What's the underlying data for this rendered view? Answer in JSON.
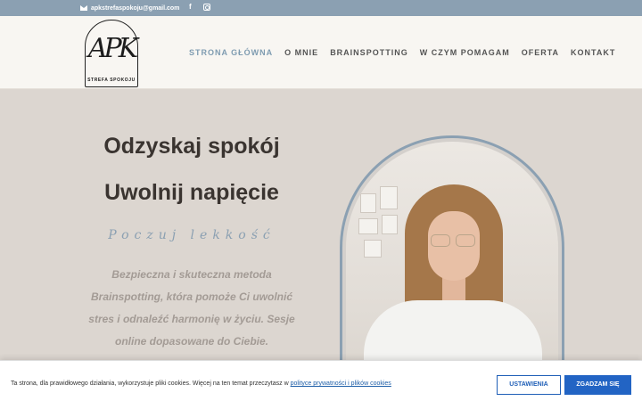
{
  "topbar": {
    "email": "apkstrefaspokoju@gmail.com",
    "facebook_icon": "facebook-icon",
    "instagram_icon": "instagram-icon"
  },
  "logo": {
    "monogram": "APK",
    "subtitle": "STREFA SPOKOJU"
  },
  "nav": {
    "items": [
      "STRONA GŁÓWNA",
      "O MNIE",
      "BRAINSPOTTING",
      "W CZYM POMAGAM",
      "OFERTA",
      "KONTAKT"
    ],
    "active_index": 0
  },
  "hero": {
    "title1": "Odzyskaj spokój",
    "title2": "Uwolnij napięcie",
    "tagline": "Poczuj lekkość",
    "description": "Bezpieczna i skuteczna metoda Brainspotting, która pomoże Ci uwolnić stres i odnaleźć harmonię w życiu. Sesje online dopasowane do Ciebie."
  },
  "cookie": {
    "text": "Ta strona, dla prawidłowego działania, wykorzystuje pliki cookies. Więcej na ten temat przeczytasz w",
    "link": "polityce prywatności i plików cookies",
    "settings_label": "USTAWIENIA",
    "accept_label": "ZGADZAM SIĘ"
  },
  "colors": {
    "accent": "#8ba0b2",
    "background": "#dcd6d0",
    "header": "#f8f6f2",
    "button": "#2264c4"
  }
}
